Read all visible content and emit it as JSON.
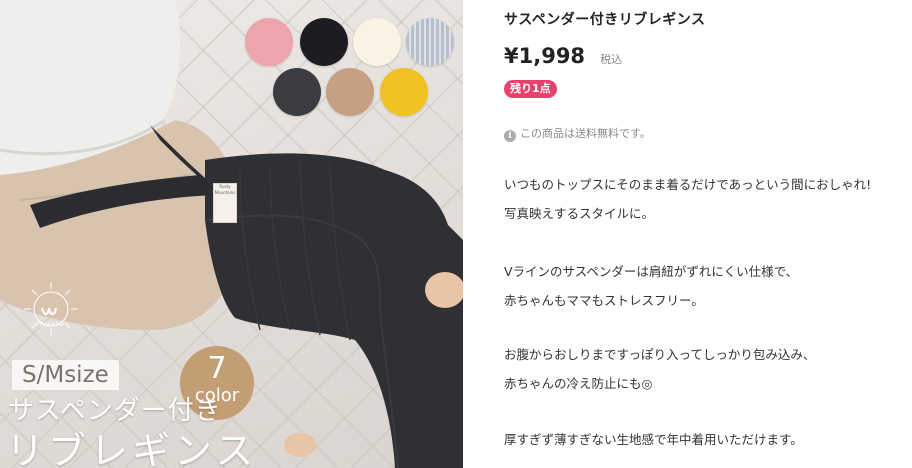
{
  "product": {
    "title": "サスペンダー付きリブレギンス",
    "price": "¥1,998",
    "tax_label": "税込",
    "stock_badge": "残り1点",
    "shipping_note": "この商品は送料無料です。",
    "description_lines": [
      "いつものトップスにそのまま着るだけであっという間におしゃれ!",
      "写真映えするスタイルに。",
      "",
      "Vラインのサスペンダーは肩紐がずれにくい仕様で、",
      "赤ちゃんもママもストレスフリー。",
      "",
      "お腹からおしりまですっぽり入ってしっかり包み込み、",
      "赤ちゃんの冷え防止にも◎",
      "",
      "厚すぎず薄すぎない生地感で年中着用いただけます。"
    ]
  },
  "image": {
    "size_badge": "S/Msize",
    "sub_title": "サスペンダー付き",
    "main_title": "リブレギンス",
    "color_count": "7",
    "color_word": "color",
    "logo_text": "muuto",
    "garment_tag_text": "Rusty Mountains",
    "swatch_colors": [
      "#eea4ac",
      "#1c1c22",
      "#f8f3e2",
      "#b6bfcb",
      "#3b3c40",
      "#c79f82",
      "#f1c322"
    ],
    "palette": {
      "sweater": "#d7c3ae",
      "leggings": "#2f3033",
      "hat": "#efeeec"
    }
  },
  "colors": {
    "stock_badge": "#e8416c",
    "muted_text": "#888888"
  }
}
